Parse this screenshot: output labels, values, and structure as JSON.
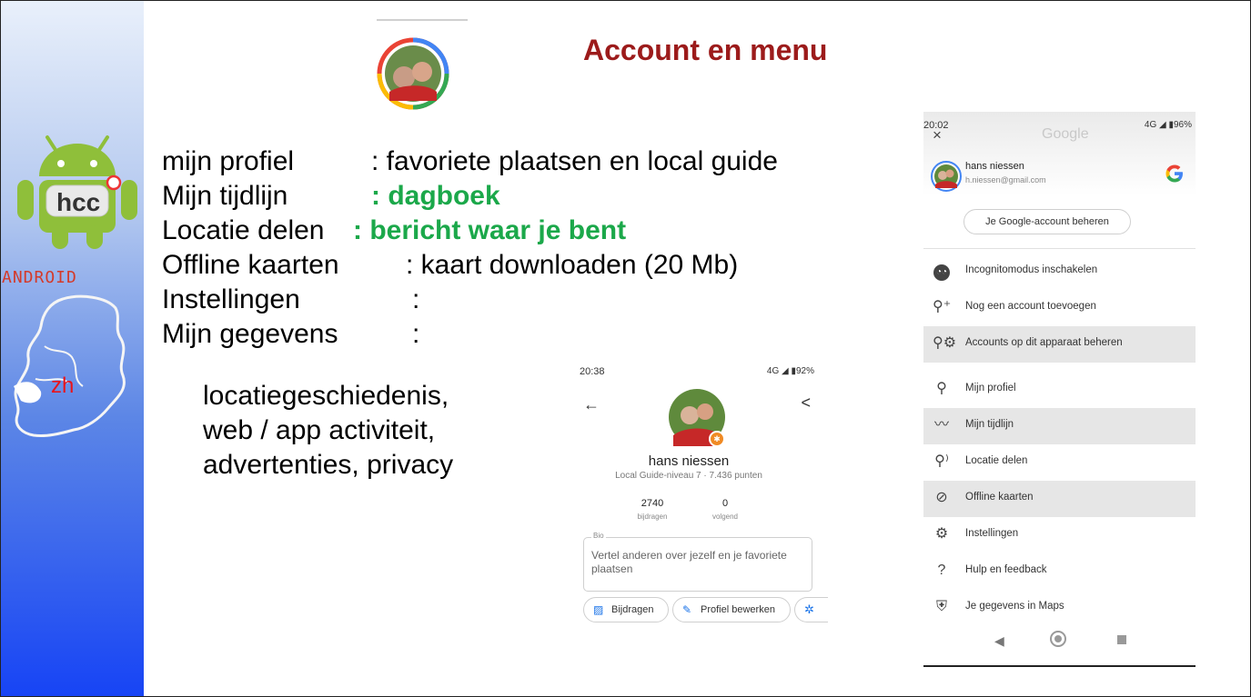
{
  "slide": {
    "title": "Account en menu",
    "logo": {
      "hcc": "hcc",
      "android_word": "ANDROID",
      "zh": "zh"
    },
    "lines": [
      {
        "label": "mijn profiel",
        "value": ": favoriete plaatsen en local guide"
      },
      {
        "label": "Mijn tijdlijn",
        "value": ": dagboek"
      },
      {
        "label": "Locatie delen",
        "value": ": bericht waar je bent"
      },
      {
        "label": "Offline kaarten",
        "value": ": kaart downloaden (20 Mb)"
      },
      {
        "label": "Instellingen",
        "value": ":"
      },
      {
        "label": "Mijn gegevens",
        "value": ":"
      }
    ],
    "sublines": [
      "locatiegeschiedenis,",
      "web / app activiteit,",
      "advertenties, privacy"
    ],
    "colors": {
      "title": "#9c1b1b",
      "highlight": "#1ba84a"
    }
  },
  "profile_screen": {
    "status_time": "20:38",
    "status_right": "4G ◢ ▮92%",
    "name": "hans niessen",
    "level": "Local Guide-niveau 7 · 7.436 punten",
    "stats": [
      {
        "value": "2740",
        "label": "bijdragen"
      },
      {
        "value": "0",
        "label": "volgend"
      }
    ],
    "bio_label": "Bio",
    "bio_placeholder": "Vertel anderen over jezelf en je favoriete plaatsen",
    "buttons": [
      "Bijdragen",
      "Profiel bewerken"
    ]
  },
  "menu_screen": {
    "status_time": "20:02",
    "status_right": "4G ◢ ▮96%",
    "header_logo": "Google",
    "account_name": "hans niessen",
    "account_email": "h.niessen@gmail.com",
    "manage_button": "Je Google-account beheren",
    "items": [
      {
        "label": "Incognitomodus inschakelen",
        "icon": "incognito-icon"
      },
      {
        "label": "Nog een account toevoegen",
        "icon": "add-person-icon"
      },
      {
        "label": "Accounts op dit apparaat beheren",
        "icon": "manage-accounts-icon"
      },
      {
        "label": "Mijn profiel",
        "icon": "person-icon"
      },
      {
        "label": "Mijn tijdlijn",
        "icon": "timeline-icon"
      },
      {
        "label": "Locatie delen",
        "icon": "location-share-icon"
      },
      {
        "label": "Offline kaarten",
        "icon": "offline-icon"
      },
      {
        "label": "Instellingen",
        "icon": "gear-icon"
      },
      {
        "label": "Hulp en feedback",
        "icon": "help-icon"
      },
      {
        "label": "Je gegevens in Maps",
        "icon": "shield-icon"
      }
    ]
  }
}
